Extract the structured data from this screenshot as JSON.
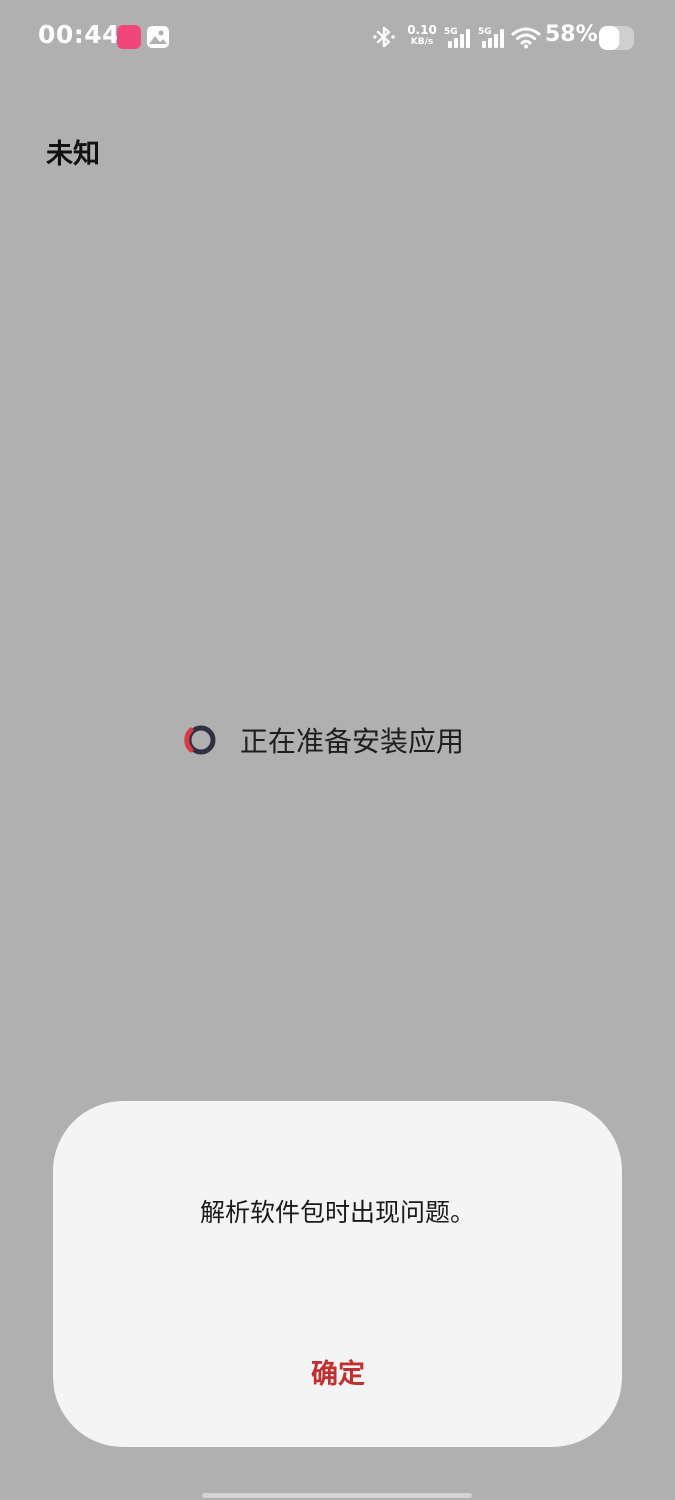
{
  "status_bar": {
    "time": "00:44",
    "net_speed_value": "0.10",
    "net_speed_unit": "KB/s",
    "signal_1_label": "5G",
    "signal_2_label": "5G",
    "battery": "58%",
    "battery_level": 0.58,
    "icons": [
      "app-notification-icon",
      "photo-icon",
      "bluetooth-icon",
      "signal-icon",
      "signal-icon",
      "wifi-icon",
      "battery-icon"
    ]
  },
  "page": {
    "title": "未知",
    "loading_text": "正在准备安装应用"
  },
  "dialog": {
    "message": "解析软件包时出现问题。",
    "confirm_label": "确定"
  },
  "colors": {
    "background": "#b0b0b0",
    "dialog_background": "#f4f4f4",
    "accent": "#c0302e",
    "spinner": "#2f3142",
    "spinner_accent": "#d63a42"
  }
}
